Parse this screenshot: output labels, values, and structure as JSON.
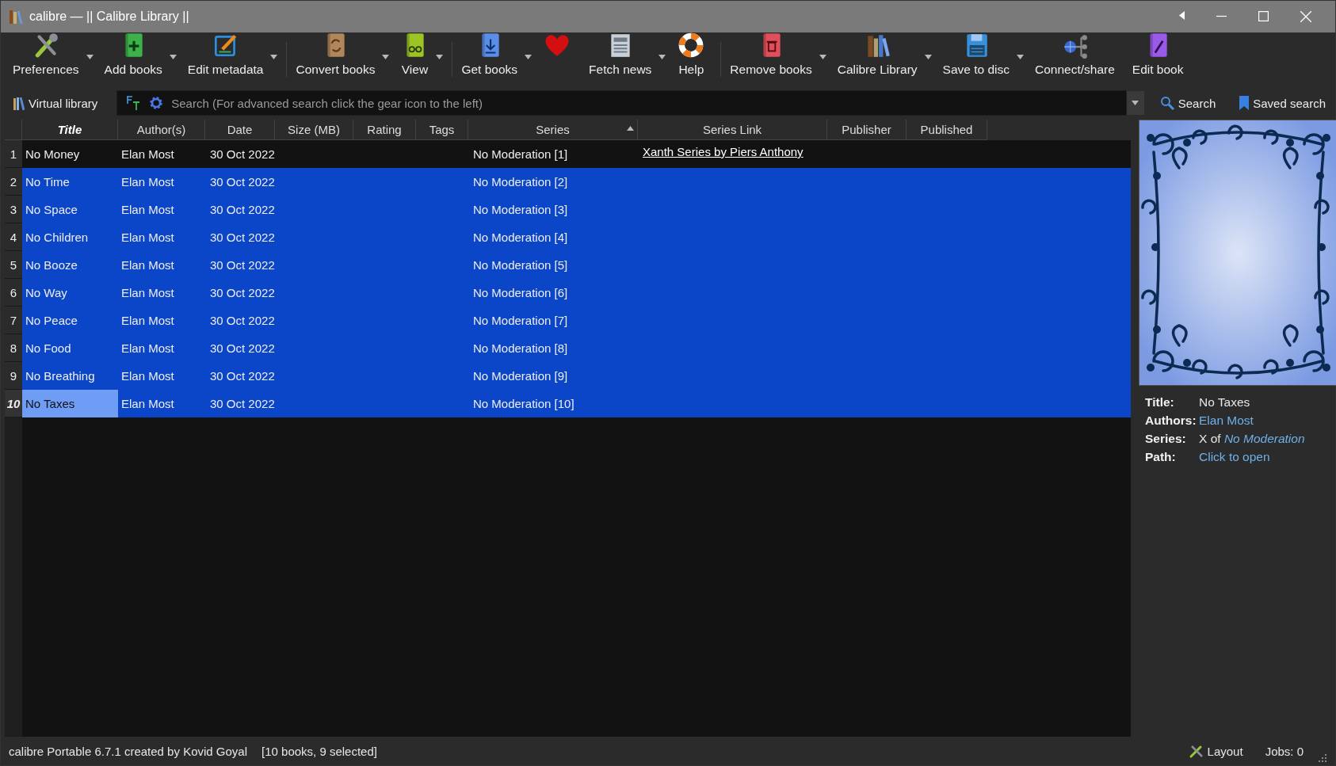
{
  "window": {
    "title": "calibre — || Calibre Library ||"
  },
  "toolbar": {
    "groups": [
      [
        {
          "label": "Preferences",
          "kind": "tools",
          "has_menu": true
        },
        {
          "label": "Add books",
          "kind": "add",
          "has_menu": true
        },
        {
          "label": "Edit metadata",
          "kind": "edit",
          "has_menu": true
        }
      ],
      [
        {
          "label": "Convert books",
          "kind": "convert",
          "has_menu": true
        },
        {
          "label": "View",
          "kind": "view",
          "has_menu": true
        }
      ],
      [
        {
          "label": "Get books",
          "kind": "get",
          "has_menu": true
        },
        {
          "kind": "heart",
          "has_menu": false
        },
        {
          "label": "Fetch news",
          "kind": "news",
          "has_menu": true
        },
        {
          "label": "Help",
          "kind": "help",
          "has_menu": false
        }
      ],
      [
        {
          "label": "Remove books",
          "kind": "remove",
          "has_menu": true
        },
        {
          "label": "Calibre Library",
          "kind": "library",
          "has_menu": true
        },
        {
          "label": "Save to disc",
          "kind": "save",
          "has_menu": true
        },
        {
          "label": "Connect/share",
          "kind": "connect",
          "has_menu": false
        },
        {
          "label": "Edit book",
          "kind": "editbook",
          "has_menu": false
        }
      ]
    ]
  },
  "search_bar": {
    "virtual_library": "Virtual library",
    "placeholder": "Search (For advanced search click the gear icon to the left)",
    "search_button": "Search",
    "saved_search_button": "Saved search"
  },
  "table": {
    "columns": [
      {
        "label": "Title",
        "current": true,
        "sorted": false
      },
      {
        "label": "Author(s)",
        "current": false,
        "sorted": false
      },
      {
        "label": "Date",
        "current": false,
        "sorted": false
      },
      {
        "label": "Size (MB)",
        "current": false,
        "sorted": false
      },
      {
        "label": "Rating",
        "current": false,
        "sorted": false
      },
      {
        "label": "Tags",
        "current": false,
        "sorted": false
      },
      {
        "label": "Series",
        "current": false,
        "sorted": true
      },
      {
        "label": "Series Link",
        "current": false,
        "sorted": false
      },
      {
        "label": "Publisher",
        "current": false,
        "sorted": false
      },
      {
        "label": "Published",
        "current": false,
        "sorted": false
      }
    ],
    "rows": [
      {
        "number": "1",
        "title": "No Money",
        "author": "Elan Most",
        "date": "30 Oct 2022",
        "series": "No Moderation [1]",
        "series_link": "Xanth Series by Piers Anthony",
        "selected": false,
        "current": false
      },
      {
        "number": "2",
        "title": "No Time",
        "author": "Elan Most",
        "date": "30 Oct 2022",
        "series": "No Moderation [2]",
        "selected": true,
        "current": false
      },
      {
        "number": "3",
        "title": "No Space",
        "author": "Elan Most",
        "date": "30 Oct 2022",
        "series": "No Moderation [3]",
        "selected": true,
        "current": false
      },
      {
        "number": "4",
        "title": "No Children",
        "author": "Elan Most",
        "date": "30 Oct 2022",
        "series": "No Moderation [4]",
        "selected": true,
        "current": false
      },
      {
        "number": "5",
        "title": "No Booze",
        "author": "Elan Most",
        "date": "30 Oct 2022",
        "series": "No Moderation [5]",
        "selected": true,
        "current": false
      },
      {
        "number": "6",
        "title": "No Way",
        "author": "Elan Most",
        "date": "30 Oct 2022",
        "series": "No Moderation [6]",
        "selected": true,
        "current": false
      },
      {
        "number": "7",
        "title": "No Peace",
        "author": "Elan Most",
        "date": "30 Oct 2022",
        "series": "No Moderation [7]",
        "selected": true,
        "current": false
      },
      {
        "number": "8",
        "title": "No Food",
        "author": "Elan Most",
        "date": "30 Oct 2022",
        "series": "No Moderation [8]",
        "selected": true,
        "current": false
      },
      {
        "number": "9",
        "title": "No Breathing",
        "author": "Elan Most",
        "date": "30 Oct 2022",
        "series": "No Moderation [9]",
        "selected": true,
        "current": false
      },
      {
        "number": "10",
        "title": "No Taxes",
        "author": "Elan Most",
        "date": "30 Oct 2022",
        "series": "No Moderation [10]",
        "selected": true,
        "current": true
      }
    ]
  },
  "details": {
    "fields": [
      {
        "label": "Title:",
        "value": "No Taxes",
        "kind": "text"
      },
      {
        "label": "Authors:",
        "value": "Elan Most",
        "kind": "link"
      },
      {
        "label": "Series:",
        "value": "X of *No Moderation*",
        "kind": "rich"
      },
      {
        "label": "Path:",
        "value": "Click to open",
        "kind": "link"
      }
    ]
  },
  "status_bar": {
    "texts": [
      "calibre Portable 6.7.1 created by Kovid Goyal",
      "[10 books, 9 selected]"
    ],
    "layout_button": "Layout",
    "jobs": "Jobs: 0"
  }
}
